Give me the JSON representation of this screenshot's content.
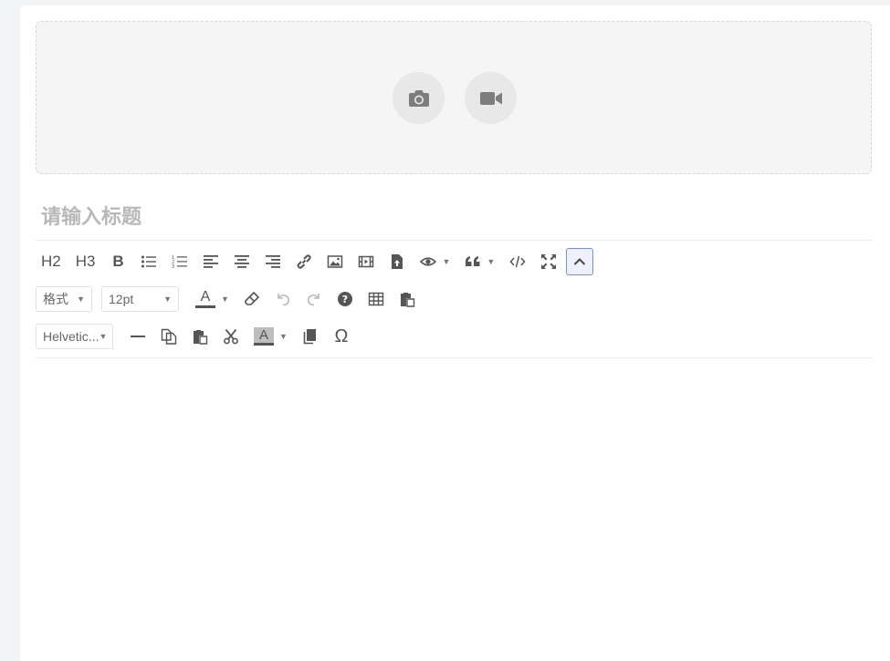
{
  "upload": {
    "camera_icon": "camera-icon",
    "video_icon": "video-camera-icon"
  },
  "title": {
    "placeholder": "请输入标题"
  },
  "toolbar": {
    "row1": {
      "h2": "H2",
      "h3": "H3",
      "bold": "B"
    },
    "row2": {
      "format_label": "格式",
      "font_size": "12pt",
      "font_color_letter": "A"
    },
    "row3": {
      "font_family": "Helvetic...",
      "bg_color_letter": "A",
      "special_char": "Ω"
    }
  }
}
